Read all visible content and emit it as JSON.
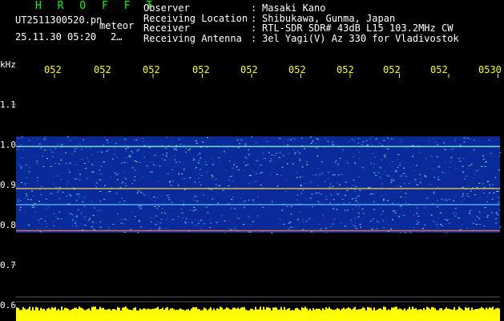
{
  "header": {
    "title": "H R O F F T",
    "filename": "UT2511300520.pn",
    "tag": "meteor",
    "datetime": "25.11.30 05:20",
    "count": "2…"
  },
  "info": [
    {
      "label": "Observer",
      "sep": ":",
      "value": "Masaki Kano"
    },
    {
      "label": "Receiving Location",
      "sep": ":",
      "value": "Shibukawa, Gunma, Japan"
    },
    {
      "label": "Receiver",
      "sep": ":",
      "value": "RTL-SDR SDR# 43dB L15 103.2MHz CW"
    },
    {
      "label": "Receiving Antenna",
      "sep": ":",
      "value": "3el Yagi(V) Az 330 for Vladivostok"
    }
  ],
  "axis": {
    "unit": "kHz",
    "y_ticks": [
      "1.1",
      "1.0",
      "0.9",
      "0.8",
      "0.7",
      "0.6"
    ],
    "x_ticks": [
      "052",
      "052",
      "052",
      "052",
      "052",
      "052",
      "052",
      "052",
      "052",
      "0530"
    ]
  },
  "colors": {
    "background": "#000000",
    "text": "#ffffff",
    "title": "#00ff00",
    "tick_label": "#ffff00",
    "signal_band": "#0a2a9a",
    "noise_floor": "#ffff00"
  },
  "chart_data": {
    "type": "heatmap",
    "ylabel": "kHz",
    "ylim": [
      0.6,
      1.15
    ],
    "band_khz": [
      0.78,
      1.02
    ],
    "lines_khz": [
      0.995,
      0.89,
      0.85,
      0.785
    ]
  }
}
